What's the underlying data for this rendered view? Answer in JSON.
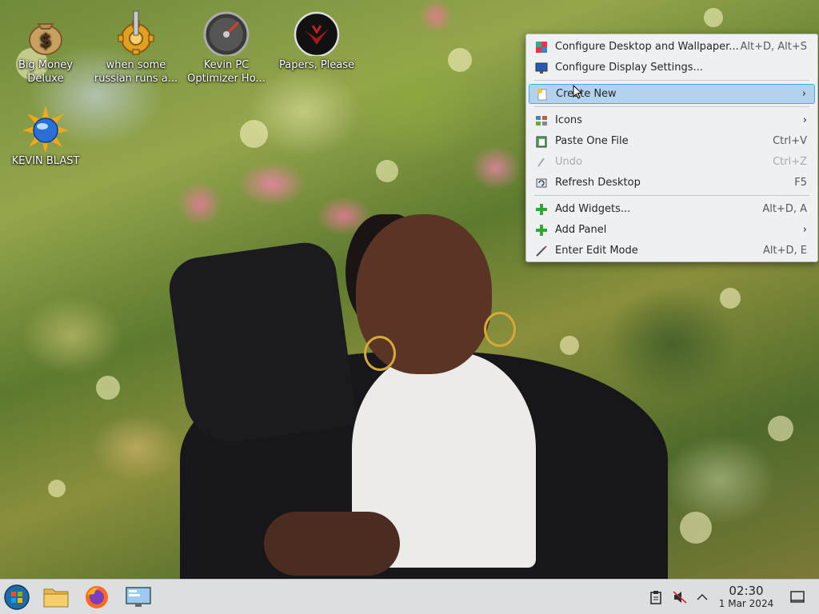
{
  "desktop": {
    "icons": [
      {
        "label": "Big Money Deluxe",
        "icon": "money-bag-icon"
      },
      {
        "label": "when some russian runs a...",
        "icon": "gear-icon"
      },
      {
        "label": "Kevin PC Optimizer Ho...",
        "icon": "speedometer-icon"
      },
      {
        "label": "Papers, Please",
        "icon": "eagle-emblem-icon"
      },
      {
        "label": "KEVIN BLAST",
        "icon": "blue-orb-starburst-icon"
      }
    ]
  },
  "context_menu": {
    "items": [
      {
        "label": "Configure Desktop and Wallpaper...",
        "shortcut": "Alt+D, Alt+S",
        "icon": "desktop-settings-icon"
      },
      {
        "label": "Configure Display Settings...",
        "shortcut": "",
        "icon": "display-icon"
      },
      {
        "label": "Create New",
        "shortcut": "",
        "icon": "new-file-icon",
        "submenu": true,
        "highlighted": true
      },
      {
        "label": "Icons",
        "shortcut": "",
        "icon": "icons-grid-icon",
        "submenu": true
      },
      {
        "label": "Paste One File",
        "shortcut": "Ctrl+V",
        "icon": "paste-icon"
      },
      {
        "label": "Undo",
        "shortcut": "Ctrl+Z",
        "icon": "undo-icon",
        "disabled": true
      },
      {
        "label": "Refresh Desktop",
        "shortcut": "F5",
        "icon": "refresh-icon"
      },
      {
        "label": "Add Widgets...",
        "shortcut": "Alt+D, A",
        "icon": "plus-icon"
      },
      {
        "label": "Add Panel",
        "shortcut": "",
        "icon": "plus-icon",
        "submenu": true
      },
      {
        "label": "Enter Edit Mode",
        "shortcut": "Alt+D, E",
        "icon": "pencil-icon"
      }
    ],
    "submenu_arrow": "›",
    "highlight_color": "#b4d2ee",
    "highlight_border": "#3daee9"
  },
  "taskbar": {
    "launchers": [
      {
        "name": "start-menu-button",
        "icon": "windows-orb-icon"
      },
      {
        "name": "file-manager-button",
        "icon": "folder-icon"
      },
      {
        "name": "firefox-button",
        "icon": "firefox-icon"
      },
      {
        "name": "system-settings-button",
        "icon": "computer-settings-icon"
      }
    ],
    "tray": [
      "clipboard-icon",
      "volume-muted-icon",
      "chevron-up-icon"
    ],
    "clock": {
      "time": "02:30",
      "date": "1 Mar 2024"
    },
    "show_desktop_icon": "show-desktop-icon"
  }
}
